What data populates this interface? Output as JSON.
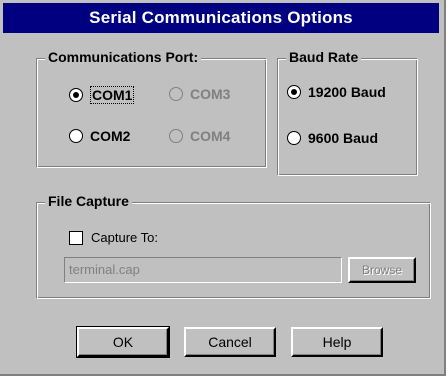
{
  "dialog": {
    "title": "Serial Communications Options"
  },
  "port_group": {
    "label": "Communications Port:",
    "options": [
      {
        "label": "COM1",
        "selected": true,
        "enabled": true
      },
      {
        "label": "COM3",
        "selected": false,
        "enabled": false
      },
      {
        "label": "COM2",
        "selected": false,
        "enabled": true
      },
      {
        "label": "COM4",
        "selected": false,
        "enabled": false
      }
    ]
  },
  "baud_group": {
    "label": "Baud Rate",
    "options": [
      {
        "label": "19200 Baud",
        "selected": true
      },
      {
        "label": "9600 Baud",
        "selected": false
      }
    ]
  },
  "capture_group": {
    "label": "File Capture",
    "checkbox_label": "Capture To:",
    "checked": false,
    "file_value": "terminal.cap",
    "browse_label": "Browse"
  },
  "buttons": {
    "ok_label": "OK",
    "cancel_label": "Cancel",
    "help_label": "Help"
  },
  "colors": {
    "title_bar": "#000080",
    "face": "#c0c0c0",
    "disabled_text": "#808080"
  }
}
